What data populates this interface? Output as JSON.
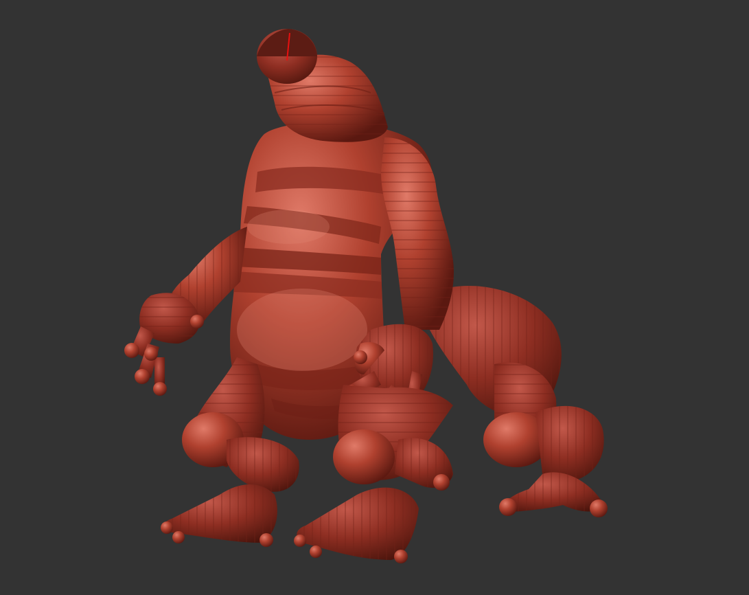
{
  "scene": {
    "background_color": "#333333",
    "subject": "zsphere-creature-sculpt",
    "material": {
      "base_color": "#a83a2c",
      "highlight_color": "#e07a68",
      "shadow_color": "#5a1810",
      "band_line_color": "#7a2418"
    },
    "axis_marker_color": "#e81010",
    "visible_text": []
  }
}
